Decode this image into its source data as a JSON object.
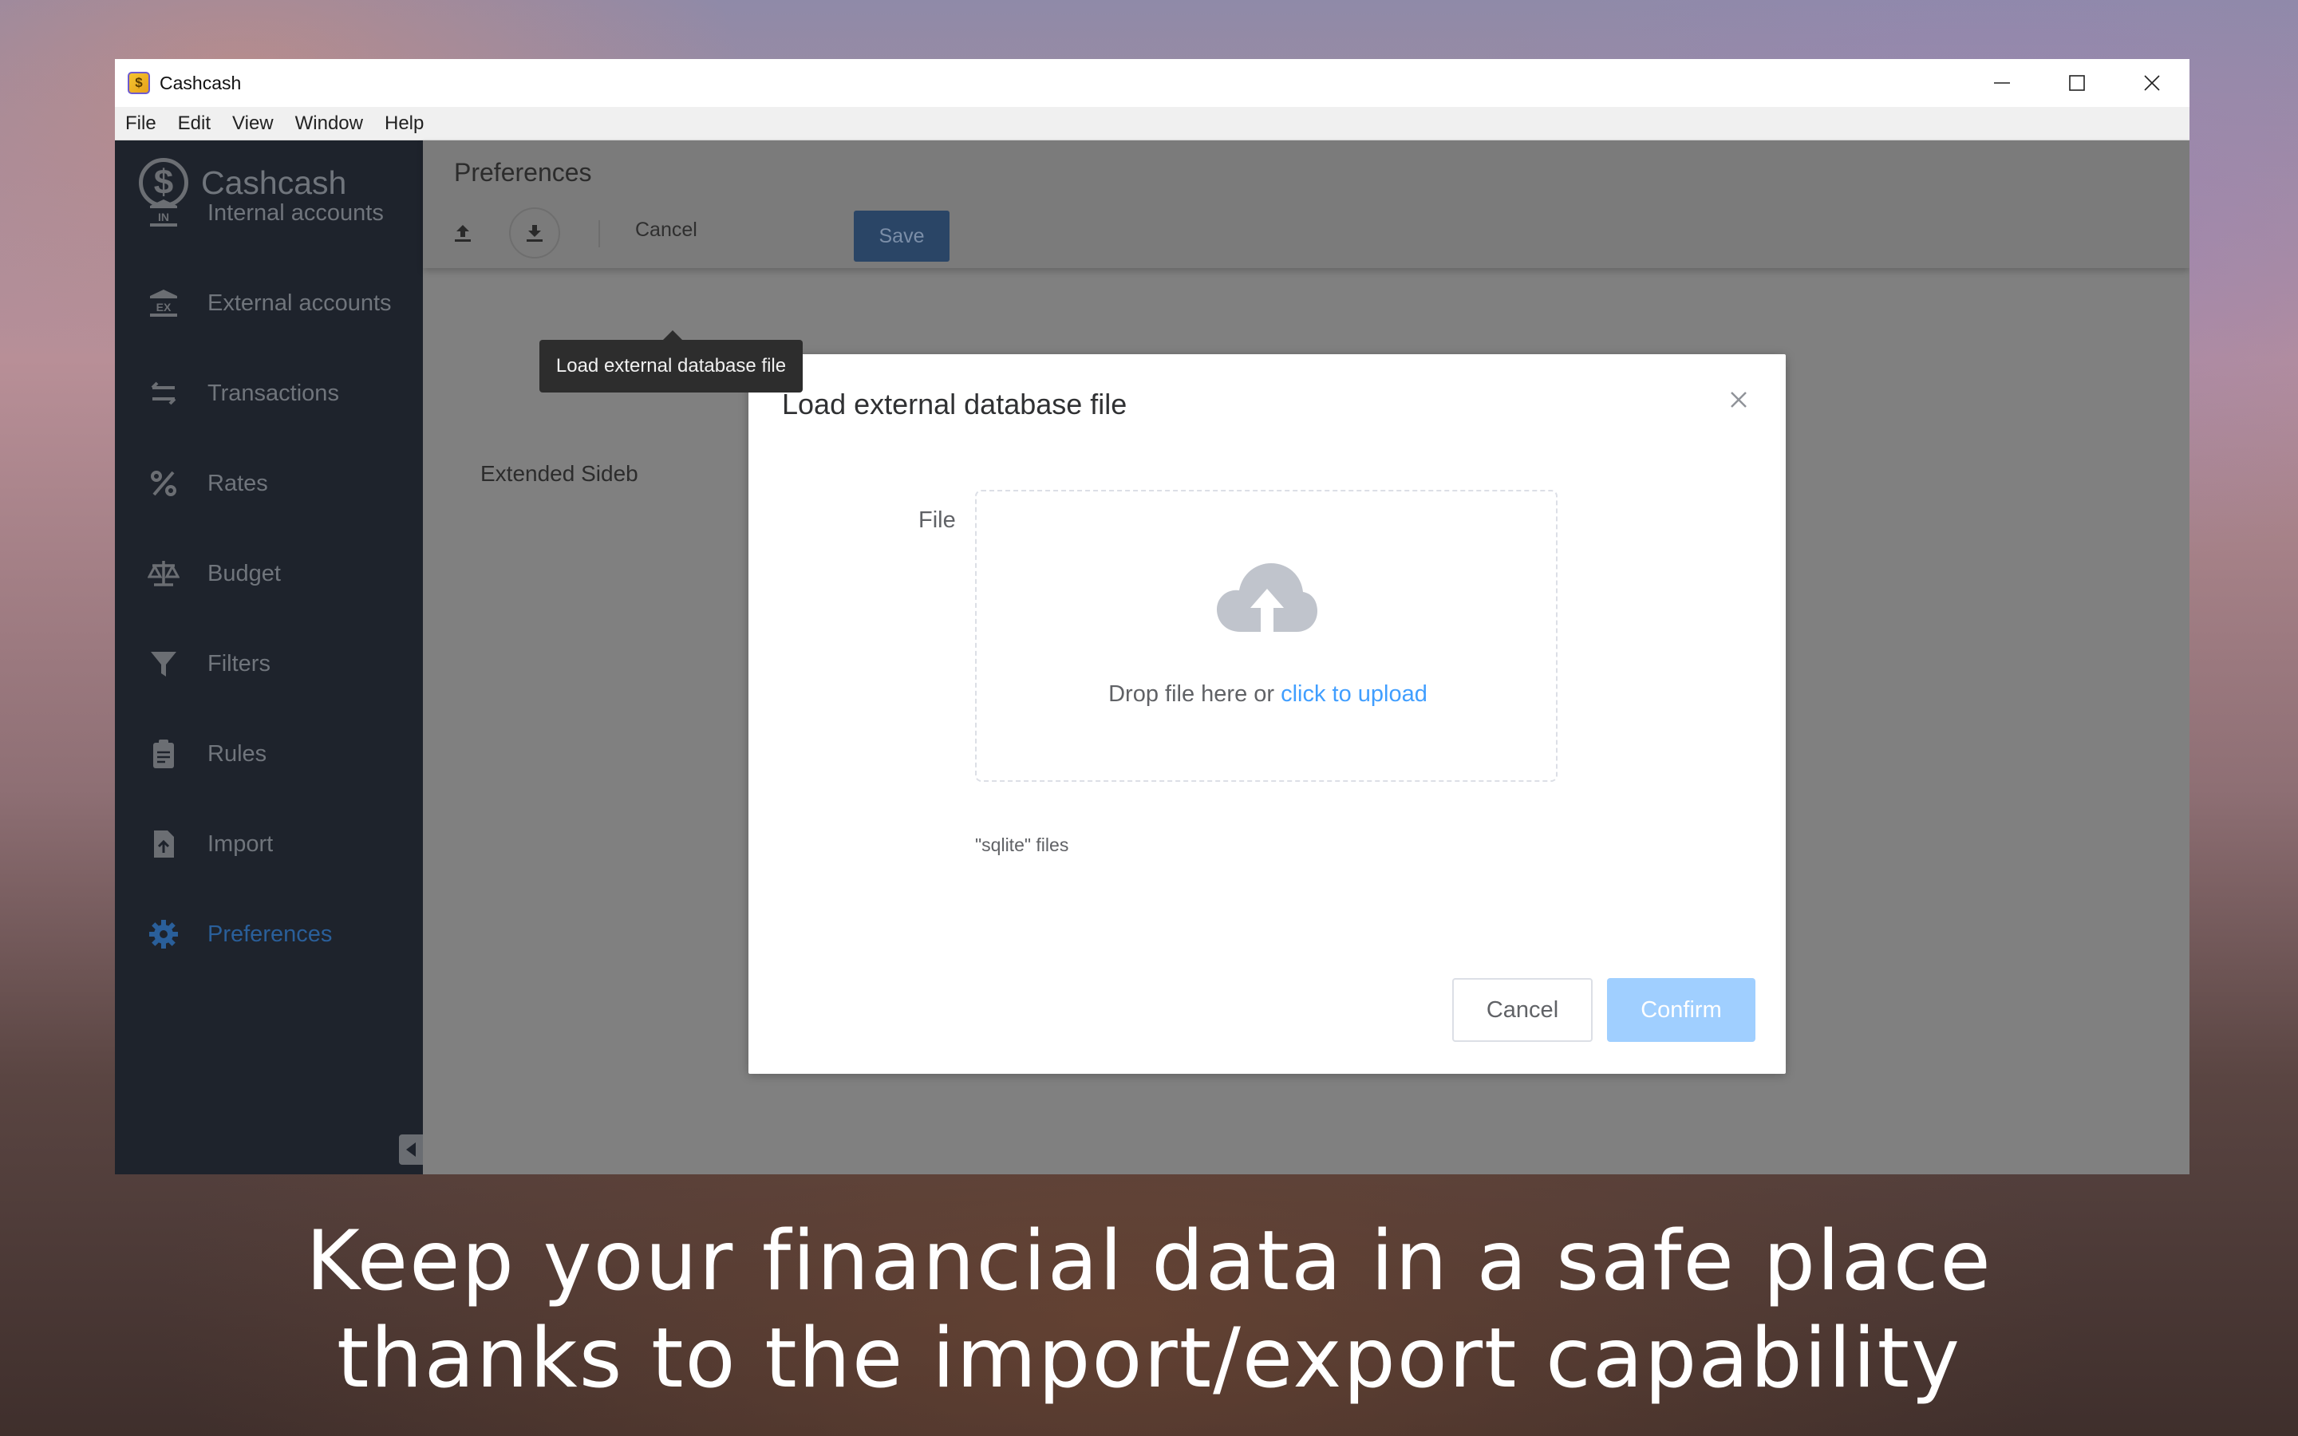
{
  "window": {
    "title": "Cashcash",
    "menu": [
      "File",
      "Edit",
      "View",
      "Window",
      "Help"
    ]
  },
  "sidebar": {
    "brand": "Cashcash",
    "items": [
      {
        "label": "Internal accounts",
        "icon": "bank-in-icon"
      },
      {
        "label": "External accounts",
        "icon": "bank-ex-icon"
      },
      {
        "label": "Transactions",
        "icon": "swap-arrows-icon"
      },
      {
        "label": "Rates",
        "icon": "percent-icon"
      },
      {
        "label": "Budget",
        "icon": "scale-icon"
      },
      {
        "label": "Filters",
        "icon": "funnel-icon"
      },
      {
        "label": "Rules",
        "icon": "clipboard-icon"
      },
      {
        "label": "Import",
        "icon": "file-import-icon"
      },
      {
        "label": "Preferences",
        "icon": "gear-icon",
        "active": true
      }
    ]
  },
  "main": {
    "title": "Preferences",
    "toolbar": {
      "cancel_label": "Cancel",
      "save_label": "Save",
      "tooltip": "Load external database file"
    },
    "extended_label": "Extended Sideb"
  },
  "dialog": {
    "title": "Load external database file",
    "field_label": "File",
    "drop_text": "Drop file here or ",
    "drop_link": "click to upload",
    "tip": "\"sqlite\" files",
    "cancel_label": "Cancel",
    "confirm_label": "Confirm"
  },
  "caption": {
    "line1": "Keep your financial data in a safe place",
    "line2": "thanks to the import/export capability"
  },
  "colors": {
    "sidebar_bg": "#1e232c",
    "active_nav": "#2a5f9a",
    "primary_disabled": "#a0cfff",
    "link": "#409eff"
  }
}
